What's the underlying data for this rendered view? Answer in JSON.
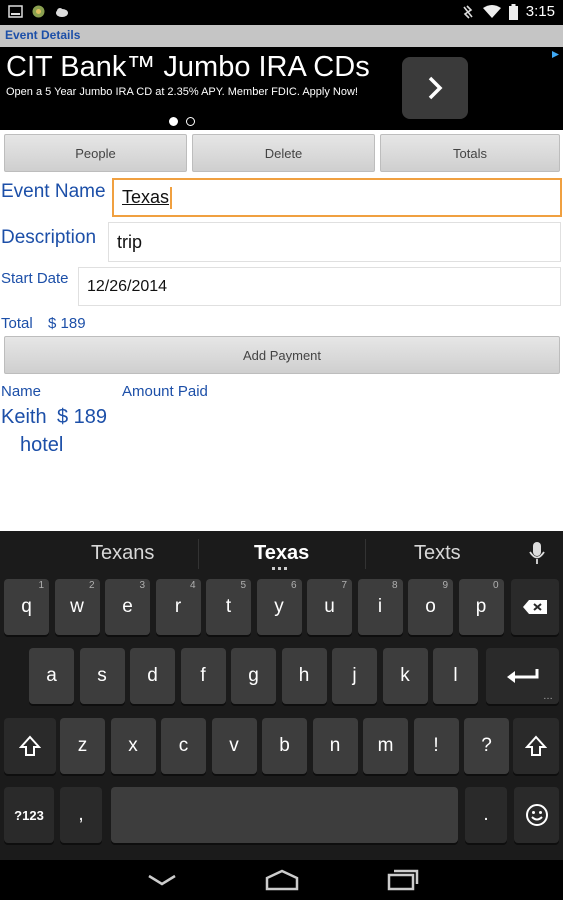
{
  "status_bar": {
    "time": "3:15"
  },
  "title_bar": {
    "title": "Event Details"
  },
  "ad": {
    "headline": "CIT Bank™ Jumbo IRA CDs",
    "text": "Open a 5 Year Jumbo IRA CD at 2.35% APY. Member FDIC. Apply Now!"
  },
  "toolbar": {
    "people": "People",
    "delete": "Delete",
    "totals": "Totals"
  },
  "form": {
    "event_name_label": "Event Name",
    "event_name_value": "Texas",
    "description_label": "Description",
    "description_value": "trip",
    "start_date_label": "Start Date",
    "start_date_value": "12/26/2014"
  },
  "total": {
    "label": "Total",
    "amount": "$ 189"
  },
  "add_payment": "Add Payment",
  "payments": {
    "headers": {
      "name": "Name",
      "amount": "Amount Paid"
    },
    "rows": [
      {
        "name": "Keith",
        "amount": "$ 189",
        "note": "hotel"
      }
    ]
  },
  "keyboard": {
    "suggestions": [
      "Texans",
      "Texas",
      "Texts"
    ],
    "row1": [
      {
        "k": "q",
        "h": "1"
      },
      {
        "k": "w",
        "h": "2"
      },
      {
        "k": "e",
        "h": "3"
      },
      {
        "k": "r",
        "h": "4"
      },
      {
        "k": "t",
        "h": "5"
      },
      {
        "k": "y",
        "h": "6"
      },
      {
        "k": "u",
        "h": "7"
      },
      {
        "k": "i",
        "h": "8"
      },
      {
        "k": "o",
        "h": "9"
      },
      {
        "k": "p",
        "h": "0"
      }
    ],
    "row2": [
      "a",
      "s",
      "d",
      "f",
      "g",
      "h",
      "j",
      "k",
      "l"
    ],
    "row3": [
      "z",
      "x",
      "c",
      "v",
      "b",
      "n",
      "m",
      "!",
      "?"
    ],
    "symbols_key": "?123",
    "comma_key": ",",
    "period_key": "."
  },
  "colors": {
    "accent": "#1c4fa8",
    "focus": "#f0a040",
    "keyboard_bg": "#1b1b1b"
  }
}
